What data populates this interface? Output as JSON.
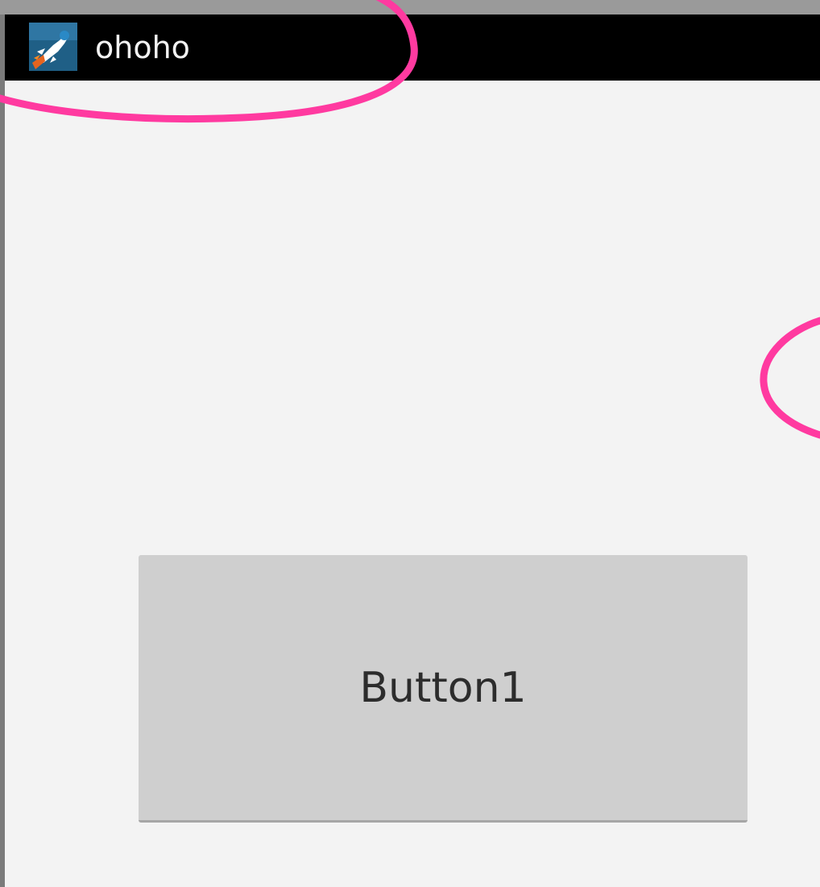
{
  "window": {
    "title": "ohoho",
    "app_icon": "rocket-app-icon"
  },
  "main": {
    "button_label": "Button1"
  },
  "colors": {
    "action_bar": "#000000",
    "title_text": "#f2f2f2",
    "background": "#f3f3f3",
    "button_fill": "#cfcfcf",
    "button_text": "#2c2c2c",
    "annotation": "#ff3aa0"
  }
}
